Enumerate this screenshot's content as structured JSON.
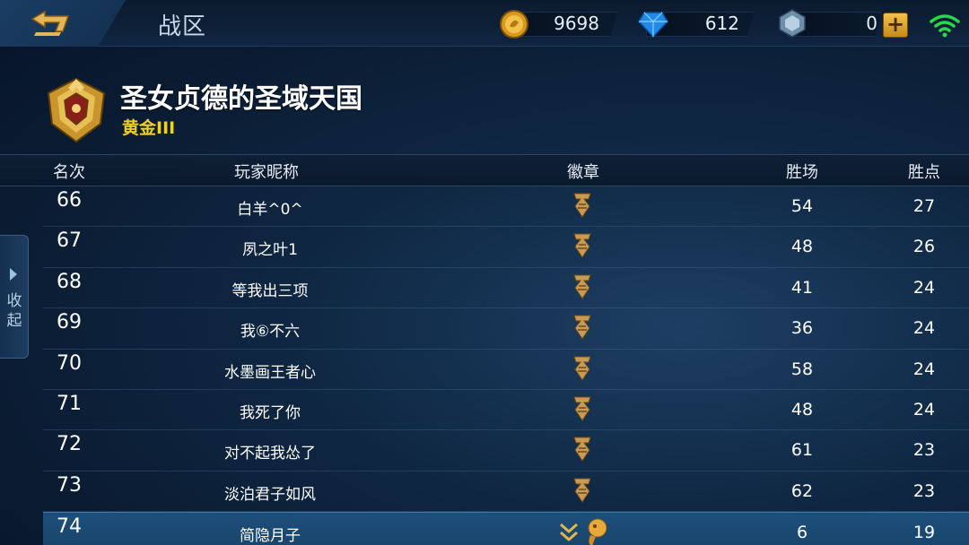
{
  "header": {
    "page_title": "战区",
    "gold": "9698",
    "diamonds": "612",
    "coupons": "0"
  },
  "zone": {
    "name": "圣女贞德的圣域天国",
    "tier": "黄金III"
  },
  "side_tab": {
    "label_line1": "收",
    "label_line2": "起"
  },
  "table": {
    "columns": [
      "名次",
      "玩家昵称",
      "徽章",
      "胜场",
      "胜点"
    ],
    "rows": [
      {
        "rank": "66",
        "name": "白羊^0^",
        "wins": "54",
        "points": "27"
      },
      {
        "rank": "67",
        "name": "夙之叶1",
        "wins": "48",
        "points": "26"
      },
      {
        "rank": "68",
        "name": "等我出三项",
        "wins": "41",
        "points": "24"
      },
      {
        "rank": "69",
        "name": "我⑥不六",
        "wins": "36",
        "points": "24"
      },
      {
        "rank": "70",
        "name": "水墨画王者心",
        "wins": "58",
        "points": "24"
      },
      {
        "rank": "71",
        "name": "我死了你",
        "wins": "48",
        "points": "24"
      },
      {
        "rank": "72",
        "name": "对不起我怂了",
        "wins": "61",
        "points": "23"
      },
      {
        "rank": "73",
        "name": "淡泊君子如风",
        "wins": "62",
        "points": "23"
      },
      {
        "rank": "74",
        "name": "简隐月子",
        "wins": "6",
        "points": "19"
      }
    ]
  },
  "colors": {
    "accent_gold": "#f0d020",
    "highlight_row": "#1d4f7c",
    "wifi_green": "#28d84a"
  },
  "icons": [
    "back-arrow-icon",
    "gold-coin-icon",
    "diamond-icon",
    "coupon-icon",
    "plus-icon",
    "wifi-icon",
    "rank-emblem-icon",
    "badge-icon",
    "chevron-down-icon",
    "mascot-icon",
    "triangle-arrow-icon"
  ]
}
